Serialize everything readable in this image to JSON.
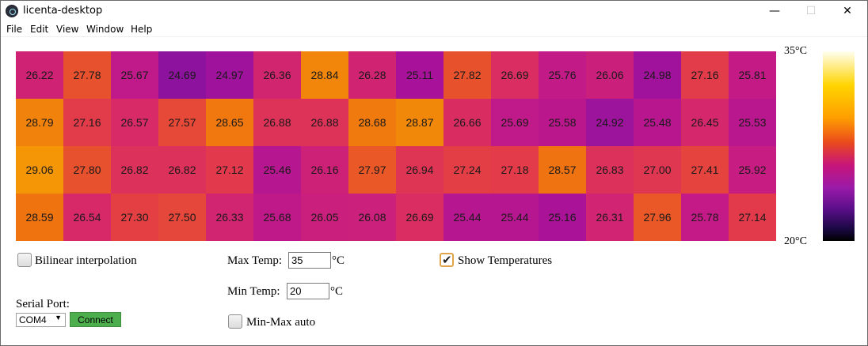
{
  "window": {
    "title": "licenta-desktop",
    "controls": {
      "minimize": "—",
      "maximize": "☐",
      "close": "✕"
    }
  },
  "menu": [
    "File",
    "Edit",
    "View",
    "Window",
    "Help"
  ],
  "heatmap": {
    "rows": [
      [
        "26.22",
        "27.78",
        "25.67",
        "24.69",
        "24.97",
        "26.36",
        "28.84",
        "26.28",
        "25.11",
        "27.82",
        "26.69",
        "25.76",
        "26.06",
        "24.98",
        "27.16",
        "25.81"
      ],
      [
        "28.79",
        "27.16",
        "26.57",
        "27.57",
        "28.65",
        "26.88",
        "26.88",
        "28.68",
        "28.87",
        "26.66",
        "25.69",
        "25.58",
        "24.92",
        "25.48",
        "26.45",
        "25.53"
      ],
      [
        "29.06",
        "27.80",
        "26.82",
        "26.82",
        "27.12",
        "25.46",
        "26.16",
        "27.97",
        "26.94",
        "27.24",
        "27.18",
        "28.57",
        "26.83",
        "27.00",
        "27.41",
        "25.92"
      ],
      [
        "28.59",
        "26.54",
        "27.30",
        "27.50",
        "26.33",
        "25.68",
        "26.05",
        "26.08",
        "26.69",
        "25.44",
        "25.44",
        "25.16",
        "26.31",
        "27.96",
        "25.78",
        "27.14"
      ]
    ],
    "color_stops": [
      "#000000",
      "#2a0a55",
      "#7a14a0",
      "#a8129a",
      "#c41a86",
      "#d6286a",
      "#e33c48",
      "#e85528",
      "#ef7410",
      "#f7a800",
      "#ffe24a",
      "#fffff0"
    ]
  },
  "scale": {
    "max_label": "35°C",
    "min_label": "20°C",
    "max": 35,
    "min": 20
  },
  "controls": {
    "bilinear": {
      "label": "Bilinear interpolation",
      "checked": false
    },
    "max_temp": {
      "label": "Max Temp:",
      "value": "35",
      "unit": "°C"
    },
    "min_temp": {
      "label": "Min Temp:",
      "value": "20",
      "unit": "°C"
    },
    "minmax_auto": {
      "label": "Min-Max auto",
      "checked": false
    },
    "show_temps": {
      "label": "Show Temperatures",
      "checked": true
    },
    "serial_port": {
      "label": "Serial Port:",
      "selected": "COM4",
      "arrow": "▼"
    },
    "connect": {
      "label": "Connect"
    }
  }
}
